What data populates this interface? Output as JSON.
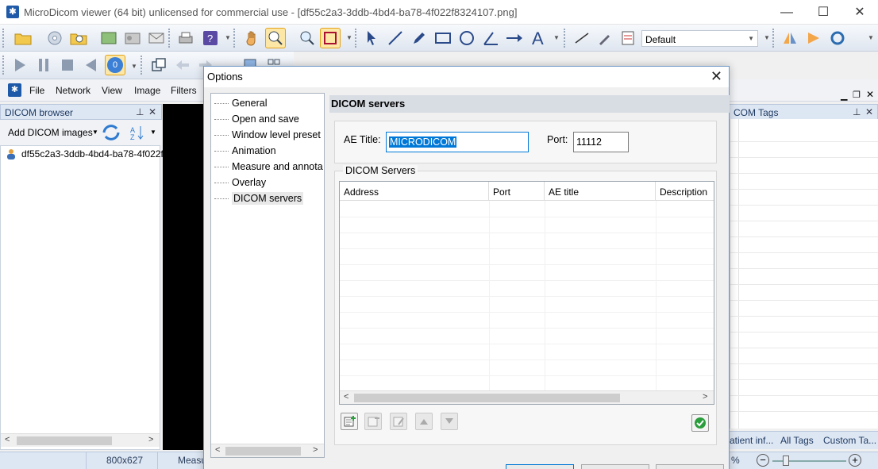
{
  "window": {
    "title": "MicroDicom viewer (64 bit) unlicensed for commercial use - [df55c2a3-3ddb-4bd4-ba78-4f022f8324107.png]",
    "minimize": "—",
    "maximize": "☐",
    "close": "✕"
  },
  "toolbar": {
    "annotation_preset": "Default",
    "frame_number": "0"
  },
  "menubar": {
    "items": [
      "File",
      "Network",
      "View",
      "Image",
      "Filters"
    ]
  },
  "dicom_browser": {
    "title": "DICOM browser",
    "add_label": "Add DICOM images",
    "file_item": "df55c2a3-3ddb-4bd4-ba78-4f022f"
  },
  "tags_panel": {
    "title": "COM Tags",
    "tabs": [
      "atient inf...",
      "All Tags",
      "Custom Ta..."
    ]
  },
  "statusbar": {
    "size": "800x627",
    "measure": "Measu",
    "zoom": "%"
  },
  "dialog": {
    "title": "Options",
    "tree": [
      "General",
      "Open and save",
      "Window level preset",
      "Animation",
      "Measure and annota",
      "Overlay",
      "DICOM servers"
    ],
    "selected": "DICOM servers",
    "header": "DICOM servers",
    "ae_title_label": "AE Title:",
    "ae_title_value": "MICRODICOM",
    "port_label": "Port:",
    "port_value": "11112",
    "servers_group": "DICOM Servers",
    "columns": [
      "Address",
      "Port",
      "AE title",
      "Description"
    ]
  },
  "colors": {
    "accent": "#0078d7",
    "panel_title_bg": "#dde6f3",
    "toolbar_active": "#fde7a6"
  }
}
